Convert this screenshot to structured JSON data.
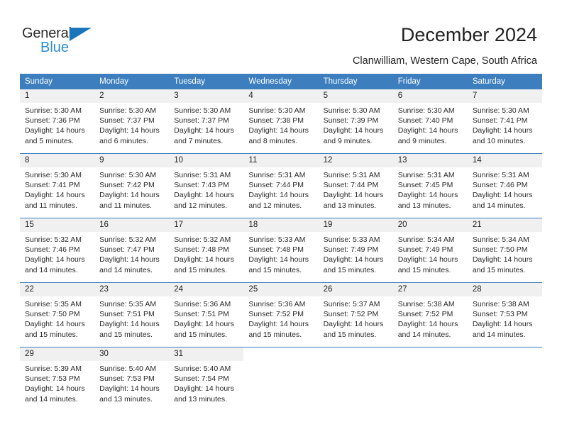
{
  "logo": {
    "name_top": "General",
    "name_bottom": "Blue",
    "triangle_icon": "logo-triangle",
    "color_dark": "#2b2b2b",
    "color_blue": "#2b8fd4",
    "triangle_color": "#1b75bb"
  },
  "header": {
    "title": "December 2024",
    "subtitle": "Clanwilliam, Western Cape, South Africa"
  },
  "colors": {
    "header_blue": "#3d7ebe",
    "daynum_band": "#f0f0f0",
    "text": "#222222"
  },
  "weekday_headers": [
    "Sunday",
    "Monday",
    "Tuesday",
    "Wednesday",
    "Thursday",
    "Friday",
    "Saturday"
  ],
  "labels": {
    "sunrise": "Sunrise:",
    "sunset": "Sunset:",
    "daylight": "Daylight:"
  },
  "weeks": [
    [
      {
        "day": "1",
        "sunrise": "Sunrise: 5:30 AM",
        "sunset": "Sunset: 7:36 PM",
        "daylight_l1": "Daylight: 14 hours",
        "daylight_l2": "and 5 minutes."
      },
      {
        "day": "2",
        "sunrise": "Sunrise: 5:30 AM",
        "sunset": "Sunset: 7:37 PM",
        "daylight_l1": "Daylight: 14 hours",
        "daylight_l2": "and 6 minutes."
      },
      {
        "day": "3",
        "sunrise": "Sunrise: 5:30 AM",
        "sunset": "Sunset: 7:37 PM",
        "daylight_l1": "Daylight: 14 hours",
        "daylight_l2": "and 7 minutes."
      },
      {
        "day": "4",
        "sunrise": "Sunrise: 5:30 AM",
        "sunset": "Sunset: 7:38 PM",
        "daylight_l1": "Daylight: 14 hours",
        "daylight_l2": "and 8 minutes."
      },
      {
        "day": "5",
        "sunrise": "Sunrise: 5:30 AM",
        "sunset": "Sunset: 7:39 PM",
        "daylight_l1": "Daylight: 14 hours",
        "daylight_l2": "and 9 minutes."
      },
      {
        "day": "6",
        "sunrise": "Sunrise: 5:30 AM",
        "sunset": "Sunset: 7:40 PM",
        "daylight_l1": "Daylight: 14 hours",
        "daylight_l2": "and 9 minutes."
      },
      {
        "day": "7",
        "sunrise": "Sunrise: 5:30 AM",
        "sunset": "Sunset: 7:41 PM",
        "daylight_l1": "Daylight: 14 hours",
        "daylight_l2": "and 10 minutes."
      }
    ],
    [
      {
        "day": "8",
        "sunrise": "Sunrise: 5:30 AM",
        "sunset": "Sunset: 7:41 PM",
        "daylight_l1": "Daylight: 14 hours",
        "daylight_l2": "and 11 minutes."
      },
      {
        "day": "9",
        "sunrise": "Sunrise: 5:30 AM",
        "sunset": "Sunset: 7:42 PM",
        "daylight_l1": "Daylight: 14 hours",
        "daylight_l2": "and 11 minutes."
      },
      {
        "day": "10",
        "sunrise": "Sunrise: 5:31 AM",
        "sunset": "Sunset: 7:43 PM",
        "daylight_l1": "Daylight: 14 hours",
        "daylight_l2": "and 12 minutes."
      },
      {
        "day": "11",
        "sunrise": "Sunrise: 5:31 AM",
        "sunset": "Sunset: 7:44 PM",
        "daylight_l1": "Daylight: 14 hours",
        "daylight_l2": "and 12 minutes."
      },
      {
        "day": "12",
        "sunrise": "Sunrise: 5:31 AM",
        "sunset": "Sunset: 7:44 PM",
        "daylight_l1": "Daylight: 14 hours",
        "daylight_l2": "and 13 minutes."
      },
      {
        "day": "13",
        "sunrise": "Sunrise: 5:31 AM",
        "sunset": "Sunset: 7:45 PM",
        "daylight_l1": "Daylight: 14 hours",
        "daylight_l2": "and 13 minutes."
      },
      {
        "day": "14",
        "sunrise": "Sunrise: 5:31 AM",
        "sunset": "Sunset: 7:46 PM",
        "daylight_l1": "Daylight: 14 hours",
        "daylight_l2": "and 14 minutes."
      }
    ],
    [
      {
        "day": "15",
        "sunrise": "Sunrise: 5:32 AM",
        "sunset": "Sunset: 7:46 PM",
        "daylight_l1": "Daylight: 14 hours",
        "daylight_l2": "and 14 minutes."
      },
      {
        "day": "16",
        "sunrise": "Sunrise: 5:32 AM",
        "sunset": "Sunset: 7:47 PM",
        "daylight_l1": "Daylight: 14 hours",
        "daylight_l2": "and 14 minutes."
      },
      {
        "day": "17",
        "sunrise": "Sunrise: 5:32 AM",
        "sunset": "Sunset: 7:48 PM",
        "daylight_l1": "Daylight: 14 hours",
        "daylight_l2": "and 15 minutes."
      },
      {
        "day": "18",
        "sunrise": "Sunrise: 5:33 AM",
        "sunset": "Sunset: 7:48 PM",
        "daylight_l1": "Daylight: 14 hours",
        "daylight_l2": "and 15 minutes."
      },
      {
        "day": "19",
        "sunrise": "Sunrise: 5:33 AM",
        "sunset": "Sunset: 7:49 PM",
        "daylight_l1": "Daylight: 14 hours",
        "daylight_l2": "and 15 minutes."
      },
      {
        "day": "20",
        "sunrise": "Sunrise: 5:34 AM",
        "sunset": "Sunset: 7:49 PM",
        "daylight_l1": "Daylight: 14 hours",
        "daylight_l2": "and 15 minutes."
      },
      {
        "day": "21",
        "sunrise": "Sunrise: 5:34 AM",
        "sunset": "Sunset: 7:50 PM",
        "daylight_l1": "Daylight: 14 hours",
        "daylight_l2": "and 15 minutes."
      }
    ],
    [
      {
        "day": "22",
        "sunrise": "Sunrise: 5:35 AM",
        "sunset": "Sunset: 7:50 PM",
        "daylight_l1": "Daylight: 14 hours",
        "daylight_l2": "and 15 minutes."
      },
      {
        "day": "23",
        "sunrise": "Sunrise: 5:35 AM",
        "sunset": "Sunset: 7:51 PM",
        "daylight_l1": "Daylight: 14 hours",
        "daylight_l2": "and 15 minutes."
      },
      {
        "day": "24",
        "sunrise": "Sunrise: 5:36 AM",
        "sunset": "Sunset: 7:51 PM",
        "daylight_l1": "Daylight: 14 hours",
        "daylight_l2": "and 15 minutes."
      },
      {
        "day": "25",
        "sunrise": "Sunrise: 5:36 AM",
        "sunset": "Sunset: 7:52 PM",
        "daylight_l1": "Daylight: 14 hours",
        "daylight_l2": "and 15 minutes."
      },
      {
        "day": "26",
        "sunrise": "Sunrise: 5:37 AM",
        "sunset": "Sunset: 7:52 PM",
        "daylight_l1": "Daylight: 14 hours",
        "daylight_l2": "and 15 minutes."
      },
      {
        "day": "27",
        "sunrise": "Sunrise: 5:38 AM",
        "sunset": "Sunset: 7:52 PM",
        "daylight_l1": "Daylight: 14 hours",
        "daylight_l2": "and 14 minutes."
      },
      {
        "day": "28",
        "sunrise": "Sunrise: 5:38 AM",
        "sunset": "Sunset: 7:53 PM",
        "daylight_l1": "Daylight: 14 hours",
        "daylight_l2": "and 14 minutes."
      }
    ],
    [
      {
        "day": "29",
        "sunrise": "Sunrise: 5:39 AM",
        "sunset": "Sunset: 7:53 PM",
        "daylight_l1": "Daylight: 14 hours",
        "daylight_l2": "and 14 minutes."
      },
      {
        "day": "30",
        "sunrise": "Sunrise: 5:40 AM",
        "sunset": "Sunset: 7:53 PM",
        "daylight_l1": "Daylight: 14 hours",
        "daylight_l2": "and 13 minutes."
      },
      {
        "day": "31",
        "sunrise": "Sunrise: 5:40 AM",
        "sunset": "Sunset: 7:54 PM",
        "daylight_l1": "Daylight: 14 hours",
        "daylight_l2": "and 13 minutes."
      },
      {
        "day": "",
        "sunrise": "",
        "sunset": "",
        "daylight_l1": "",
        "daylight_l2": ""
      },
      {
        "day": "",
        "sunrise": "",
        "sunset": "",
        "daylight_l1": "",
        "daylight_l2": ""
      },
      {
        "day": "",
        "sunrise": "",
        "sunset": "",
        "daylight_l1": "",
        "daylight_l2": ""
      },
      {
        "day": "",
        "sunrise": "",
        "sunset": "",
        "daylight_l1": "",
        "daylight_l2": ""
      }
    ]
  ]
}
